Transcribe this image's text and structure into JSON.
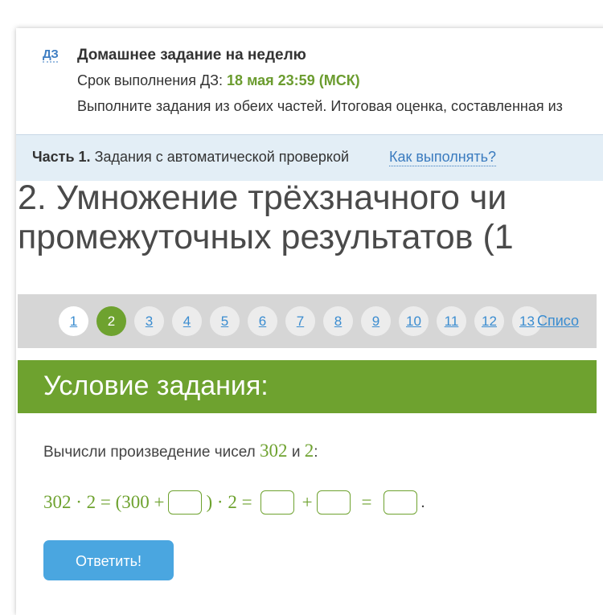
{
  "homework": {
    "icon_label": "ДЗ",
    "title": "Домашнее задание на неделю",
    "deadline_label": "Срок выполнения ДЗ:",
    "deadline_value": "18 мая 23:59 (МСК)",
    "description": "Выполните задания из обеих частей. Итоговая оценка, составленная из"
  },
  "part": {
    "number": "Часть 1.",
    "title": "Задания с автоматической проверкой",
    "how_link": "Как выполнять?"
  },
  "task": {
    "title_line1": "2. Умножение трёхзначного чи",
    "title_line2": "промежуточных результатов (1"
  },
  "pagination": {
    "items": [
      "1",
      "2",
      "3",
      "4",
      "5",
      "6",
      "7",
      "8",
      "9",
      "10",
      "11",
      "12",
      "13"
    ],
    "active": "2",
    "list_link": "Списо"
  },
  "condition": {
    "header": "Условие задания:",
    "prompt_prefix": "Вычисли произведение чисел",
    "num_a": "302",
    "conj": "и",
    "num_b": "2",
    "colon": ":",
    "eq_lhs": "302 · 2 = (300 +",
    "eq_mid": ") · 2 =",
    "eq_plus": "+",
    "eq_equals": "=",
    "eq_end": "."
  },
  "answer_button": "Ответить!",
  "colors": {
    "accent_green": "#6ea22f",
    "link_blue": "#3a8cd0",
    "button_blue": "#4aa6e0",
    "part_bar": "#e3eef6"
  }
}
